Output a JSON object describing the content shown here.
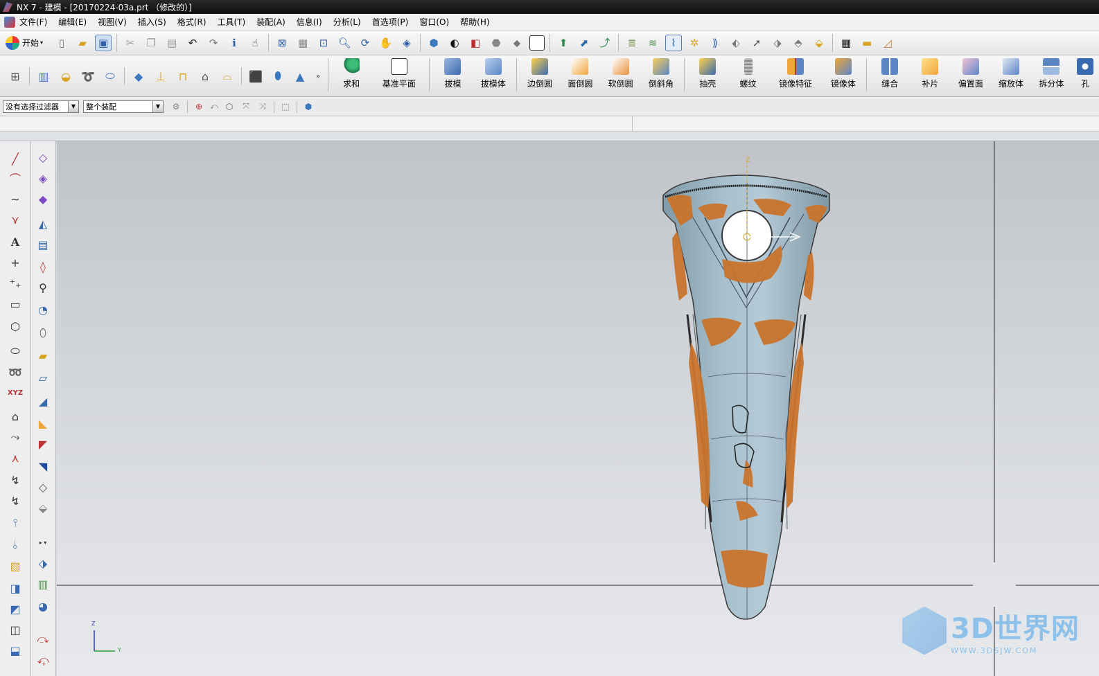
{
  "window": {
    "title": "NX 7 - 建模 - [20170224-03a.prt （修改的）]"
  },
  "menu": [
    "文件(F)",
    "编辑(E)",
    "视图(V)",
    "插入(S)",
    "格式(R)",
    "工具(T)",
    "装配(A)",
    "信息(I)",
    "分析(L)",
    "首选项(P)",
    "窗口(O)",
    "帮助(H)"
  ],
  "toolbar": {
    "start_label": "开始"
  },
  "features": {
    "unite": "求和",
    "datum_plane": "基准平面",
    "draft": "拔模",
    "draft_body": "拔模体",
    "edge_blend": "边倒圆",
    "face_blend": "面倒圆",
    "soft_blend": "软倒圆",
    "chamfer": "倒斜角",
    "shell": "抽壳",
    "thread": "螺纹",
    "mirror_feature": "镜像特征",
    "mirror_body": "镜像体",
    "sew": "缝合",
    "patch": "补片",
    "offset_face": "偏置面",
    "scale_body": "缩放体",
    "split_body": "拆分体",
    "hole": "孔"
  },
  "selection": {
    "filter": "没有选择过滤器",
    "scope": "整个装配"
  },
  "triad": {
    "z": "Z",
    "y": "Y"
  },
  "watermark": {
    "main": "3D世界网",
    "url": "WWW.3DSJW.COM"
  },
  "colors": {
    "part_body": "#9fb7c4",
    "scan_overlay": "#c9742d"
  }
}
